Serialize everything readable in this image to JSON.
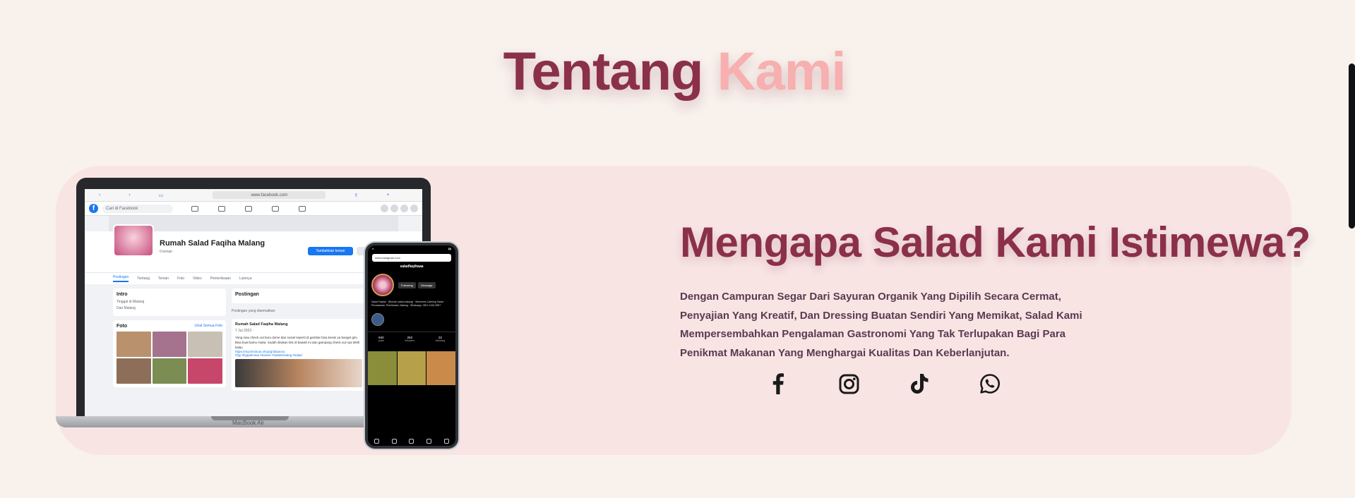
{
  "section": {
    "title_part1": "Tentang",
    "title_part2": "Kami"
  },
  "about": {
    "headline": "Mengapa Salad Kami Istimewa?",
    "description": "Dengan Campuran Segar Dari Sayuran Organik Yang Dipilih Secara Cermat, Penyajian Yang Kreatif, Dan Dressing Buatan Sendiri Yang Memikat, Salad Kami Mempersembahkan Pengalaman Gastronomi Yang Tak Terlupakan Bagi Para Penikmat Makanan Yang Menghargai Kualitas Dan Keberlanjutan."
  },
  "social": [
    {
      "name": "facebook-icon"
    },
    {
      "name": "instagram-icon"
    },
    {
      "name": "tiktok-icon"
    },
    {
      "name": "whatsapp-icon"
    }
  ],
  "mockup": {
    "laptop_label": "MacBook Air",
    "browser_url": "www.facebook.com",
    "browser_zoom": "AA",
    "fb_search": "Cari di Facebook",
    "fb_page_name": "Rumah Salad Faqiha Malang",
    "fb_page_sub": "0 teman",
    "fb_add_button": "Tambahkan teman",
    "fb_tabs": [
      "Postingan",
      "Tentang",
      "Teman",
      "Foto",
      "Video",
      "Pemeriksaan",
      "Lainnya"
    ],
    "fb_intro_title": "Intro",
    "fb_intro_line1": "Tinggal di Malang",
    "fb_intro_line2": "Dari Malang",
    "fb_photos_title": "Foto",
    "fb_photos_link": "Lihat Semua Foto",
    "fb_posts_title": "Postingan",
    "fb_pinned": "Postingan yang disematkan",
    "fb_post_author": "Rumah Salad Faqiha Malang",
    "fb_post_date": "7 Jul 2023 · ",
    "fb_post_text": "Yang mau check out buru dome dan sosial seperti di gambar bisa kesini ya banget gini. Bisa buat kamu maka. Sudah dirakan link di bawah ini dan gampang check out nya lebih kalau",
    "fb_post_link": "https://mycheckout.shop/gridsavory",
    "fb_post_tags": "#fyp #fyppelmaai #kuliner #saladmalang #salad",
    "ig_url": "www.instagram.com",
    "ig_handle": "saladfaqihaaa",
    "ig_following": "Following",
    "ig_message": "Message",
    "ig_bio": "Salad Faqiha · (Rumah salad malang) · Menerima Catering Salad · Perusahaan, Pernikahan, Malang · Whatsapp: 0812-1153-3557",
    "ig_stats": [
      {
        "value": "840",
        "label": "posts"
      },
      {
        "value": "262",
        "label": "followers"
      },
      {
        "value": "32",
        "label": "following"
      }
    ]
  },
  "colors": {
    "background": "#f8f1ec",
    "card": "#f8e5e3",
    "primary": "#8b3049",
    "accent": "#f7afaf",
    "text": "#5a3a52"
  }
}
